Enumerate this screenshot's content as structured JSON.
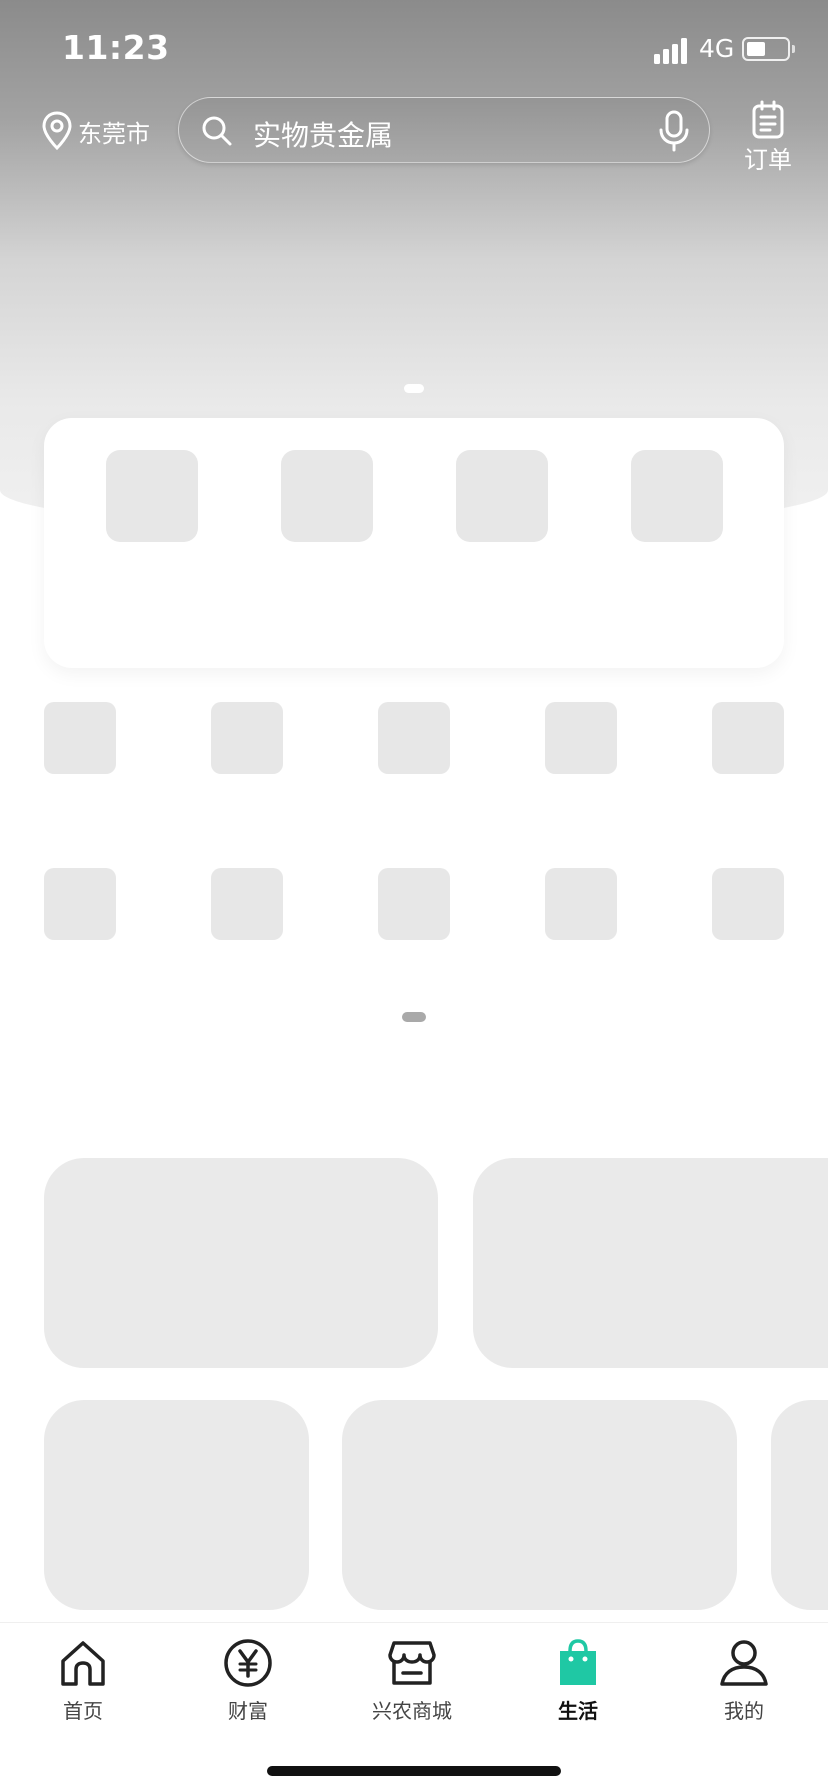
{
  "status_bar": {
    "time": "11:23",
    "network": "4G"
  },
  "header": {
    "location": "东莞市",
    "search_placeholder": "实物贵金属",
    "orders_label": "订单"
  },
  "theme": {
    "accent_color": "#1fc8a4",
    "hero_gradient_top": "#8b8b8b",
    "placeholder_color": "#e7e7e7"
  },
  "tabbar": {
    "items": [
      {
        "label": "首页",
        "icon": "home-icon"
      },
      {
        "label": "财富",
        "icon": "yen-icon"
      },
      {
        "label": "兴农商城",
        "icon": "store-icon"
      },
      {
        "label": "生活",
        "icon": "shopping-bag-icon",
        "active": true
      },
      {
        "label": "我的",
        "icon": "user-icon"
      }
    ]
  }
}
